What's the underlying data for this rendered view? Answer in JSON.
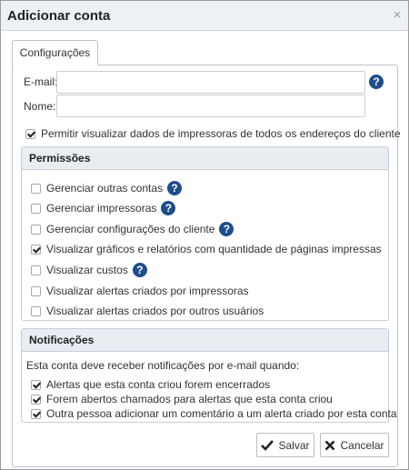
{
  "dialog": {
    "title": "Adicionar conta"
  },
  "tabs": [
    {
      "label": "Configurações"
    }
  ],
  "form": {
    "email_label": "E-mail:",
    "email_value": "",
    "name_label": "Nome:",
    "name_value": "",
    "allow_view_label": "Permitir visualizar dados de impressoras de todos os endereços do cliente",
    "allow_view_checked": true
  },
  "permissions": {
    "title": "Permissões",
    "items": [
      {
        "label": "Gerenciar outras contas",
        "checked": false,
        "help": true
      },
      {
        "label": "Gerenciar impressoras",
        "checked": false,
        "help": true
      },
      {
        "label": "Gerenciar configurações do cliente",
        "checked": false,
        "help": true
      },
      {
        "label": "Visualizar gráficos e relatórios com quantidade de páginas impressas",
        "checked": true,
        "help": false
      },
      {
        "label": "Visualizar custos",
        "checked": false,
        "help": true
      },
      {
        "label": "Visualizar alertas criados por impressoras",
        "checked": false,
        "help": false
      },
      {
        "label": "Visualizar alertas criados por outros usuários",
        "checked": false,
        "help": false
      }
    ]
  },
  "notifications": {
    "title": "Notificações",
    "intro": "Esta conta deve receber notificações por e-mail quando:",
    "items": [
      {
        "label": "Alertas que esta conta criou forem encerrados",
        "checked": true
      },
      {
        "label": "Forem abertos chamados para alertas que esta conta criou",
        "checked": true
      },
      {
        "label": "Outra pessoa adicionar um comentário a um alerta criado por esta conta",
        "checked": true
      }
    ]
  },
  "buttons": {
    "save": "Salvar",
    "cancel": "Cancelar"
  },
  "icons": {
    "close": "close-icon",
    "help": "help-icon",
    "save": "check-icon",
    "cancel": "x-icon"
  },
  "help_glyph": "?",
  "close_glyph": "×",
  "colors": {
    "help_badge": "#1e4d8c",
    "titlebar": "#eef1f4",
    "group_header": "#e8edf2"
  }
}
